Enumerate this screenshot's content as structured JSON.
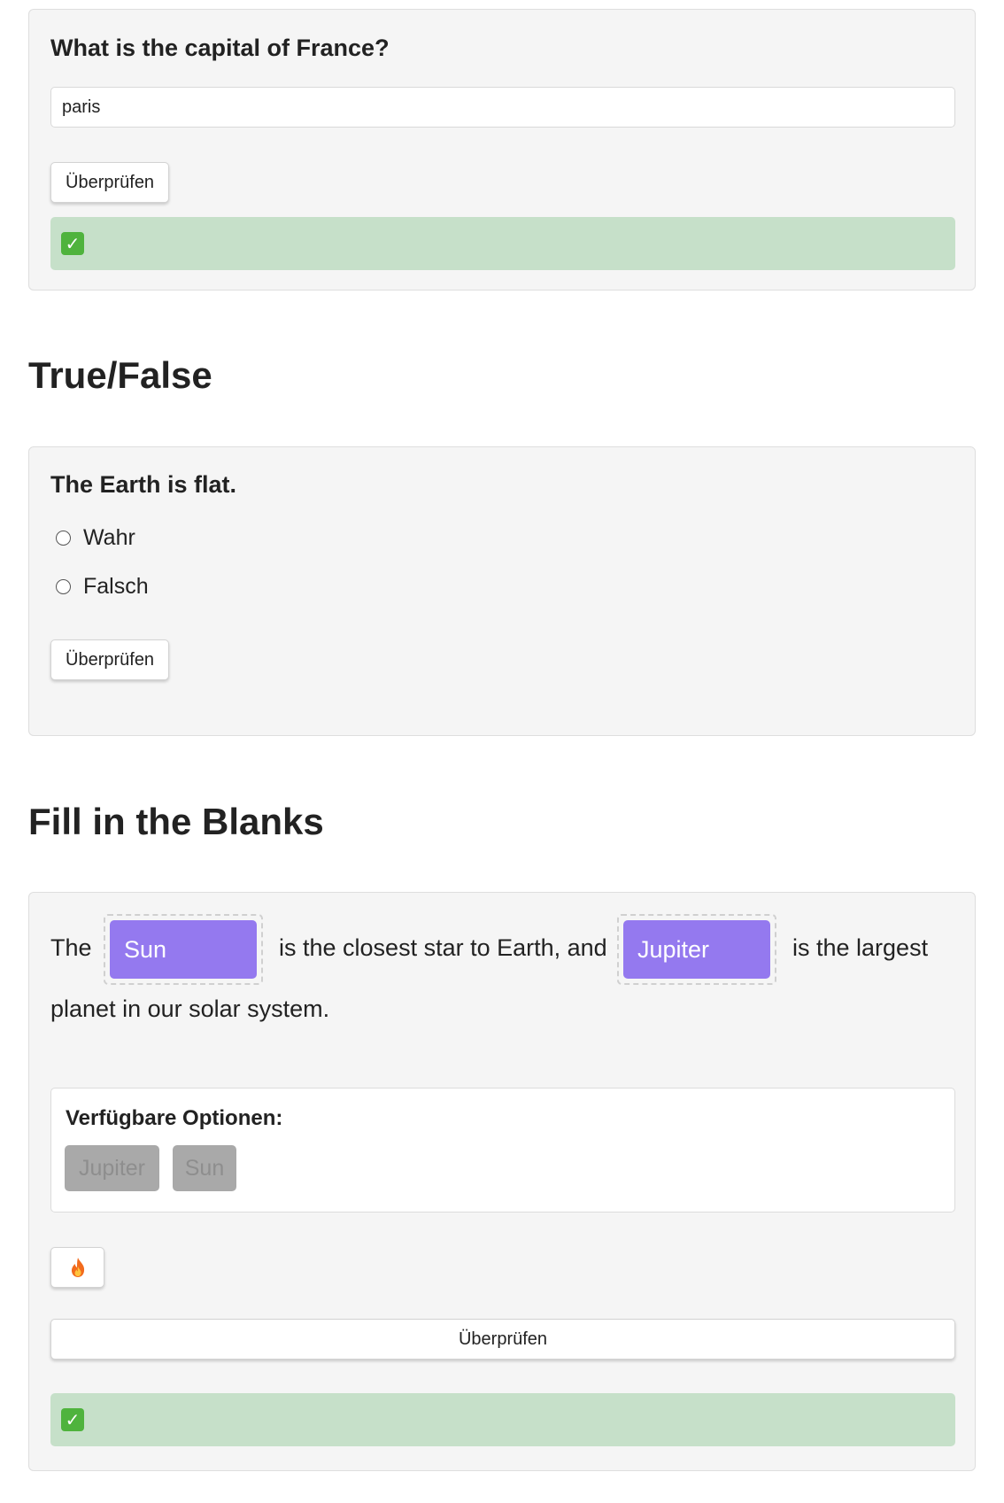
{
  "short_answer": {
    "question": "What is the capital of France?",
    "answer_value": "paris",
    "check_label": "Überprüfen",
    "feedback_icon": "check-mark-icon",
    "feedback_icon_color": "#4fb33d"
  },
  "true_false": {
    "heading": "True/False",
    "question": "The Earth is flat.",
    "options": [
      "Wahr",
      "Falsch"
    ],
    "check_label": "Überprüfen"
  },
  "fill_blanks": {
    "heading": "Fill in the Blanks",
    "text_1": "The",
    "blank_1": "Sun",
    "text_2": "is the closest star to Earth, and",
    "blank_2": "Jupiter",
    "text_3": "is the largest",
    "text_4": "planet in our solar system.",
    "options_label": "Verfügbare Optionen:",
    "options": [
      "Jupiter",
      "Sun"
    ],
    "hint_icon": "flame-icon",
    "check_label": "Überprüfen",
    "feedback_icon": "check-mark-icon"
  },
  "colors": {
    "chip_filled": "#9479ef",
    "chip_used": "#a9a9a9",
    "feedback_success": "#c6e0c9",
    "card_background": "#f5f5f5"
  }
}
